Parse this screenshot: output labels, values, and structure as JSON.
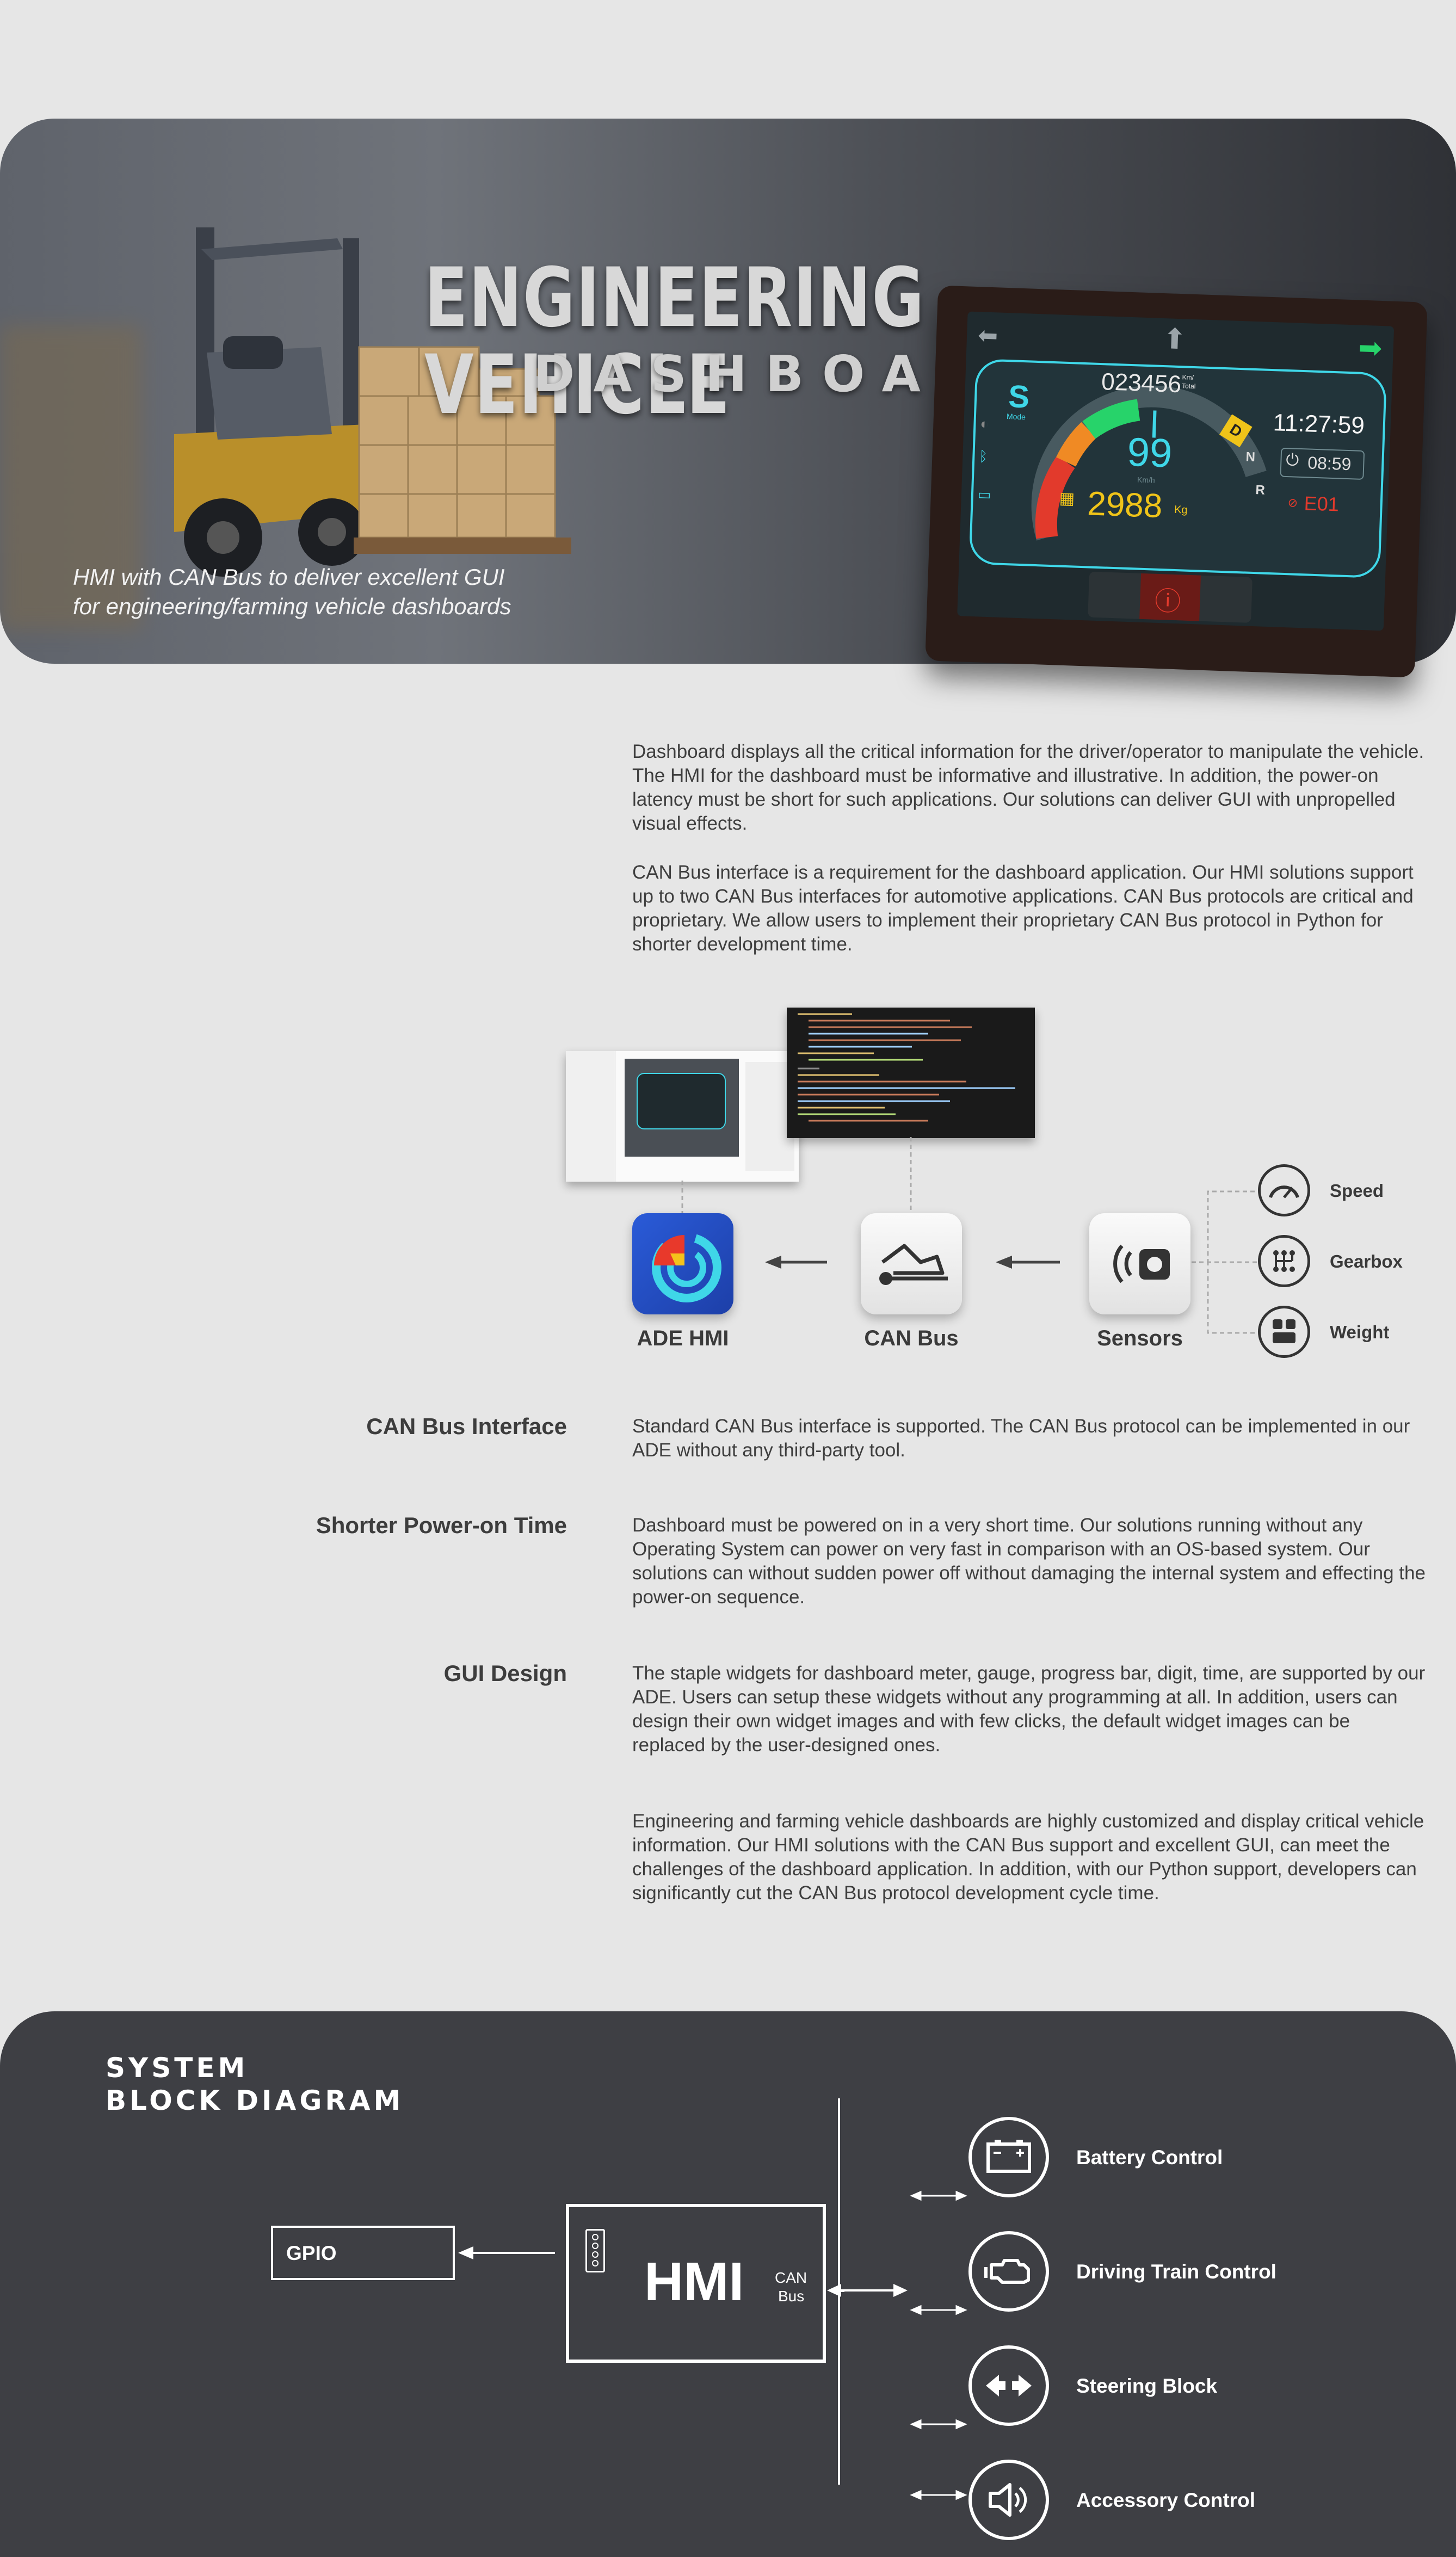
{
  "hero": {
    "title": "ENGINEERING VEHICLE",
    "subtitle": "DASHBOARDS",
    "caption_line1": "HMI with CAN Bus to deliver excellent GUI",
    "caption_line2": "for engineering/farming vehicle dashboards"
  },
  "dashboard": {
    "odometer": "023456",
    "odometer_unit_top": "Km/",
    "odometer_unit_bottom": "Total",
    "mode": "S",
    "mode_label": "Mode",
    "speed": "99",
    "speed_unit": "Km/h",
    "clock": "11:27:59",
    "power_time": "08:59",
    "weight": "2988",
    "weight_unit": "Kg",
    "error_code": "E01",
    "gear_letters": [
      "D",
      "N",
      "R"
    ],
    "colors": {
      "accent_cyan": "#3fd7e8",
      "green": "#27d36a",
      "yellow": "#f0c419",
      "red": "#e23a2c"
    }
  },
  "intro": {
    "p1": "Dashboard displays all the critical information for the driver/operator to manipulate the vehicle. The HMI for the dashboard must be informative and illustrative. In addition, the power-on latency must be short for such applications. Our solutions can deliver GUI with unpropelled visual effects.",
    "p2": "CAN Bus interface is a requirement for the dashboard application. Our HMI solutions support up to two CAN Bus interfaces for automotive applications. CAN Bus protocols are critical and proprietary. We allow users to implement their proprietary CAN Bus protocol in Python for shorter development time."
  },
  "flow": {
    "nodes": [
      {
        "label": "ADE HMI",
        "icon": "ade-hmi-logo-icon"
      },
      {
        "label": "CAN Bus",
        "icon": "can-bus-icon"
      },
      {
        "label": "Sensors",
        "icon": "sensor-icon"
      }
    ],
    "sensors": [
      {
        "label": "Speed",
        "icon": "speedometer-icon"
      },
      {
        "label": "Gearbox",
        "icon": "gearbox-icon"
      },
      {
        "label": "Weight",
        "icon": "weight-icon"
      }
    ]
  },
  "features": [
    {
      "title": "CAN Bus Interface",
      "text": "Standard CAN Bus interface is supported. The CAN Bus protocol can be implemented in our ADE without any third-party tool."
    },
    {
      "title": "Shorter Power-on Time",
      "text": "Dashboard must be powered on in a very short time. Our solutions running without any Operating System can power on very fast in comparison with an OS-based system. Our solutions can without sudden power off without damaging the internal system and effecting the power-on sequence."
    },
    {
      "title": "GUI Design",
      "text": "The staple widgets for dashboard meter, gauge, progress bar, digit, time, are supported by our ADE. Users can setup these widgets without any programming at all. In addition, users can design their own widget images and with few clicks, the default widget images can be replaced by the user-designed ones."
    }
  ],
  "closing": "Engineering and farming vehicle dashboards are highly customized and display critical vehicle information. Our HMI solutions with the CAN Bus support and excellent GUI, can meet the challenges of the dashboard application. In addition, with our Python support, developers can significantly cut the CAN Bus protocol development cycle time.",
  "system": {
    "title_line1": "SYSTEM",
    "title_line2": "BLOCK DIAGRAM",
    "gpio": "GPIO",
    "hmi": "HMI",
    "can_line1": "CAN",
    "can_line2": "Bus",
    "controls": [
      {
        "label": "Battery Control",
        "icon": "battery-icon"
      },
      {
        "label": "Driving Train Control",
        "icon": "engine-icon"
      },
      {
        "label": "Steering Block",
        "icon": "steering-arrows-icon"
      },
      {
        "label": "Accessory Control",
        "icon": "speaker-icon"
      }
    ]
  }
}
